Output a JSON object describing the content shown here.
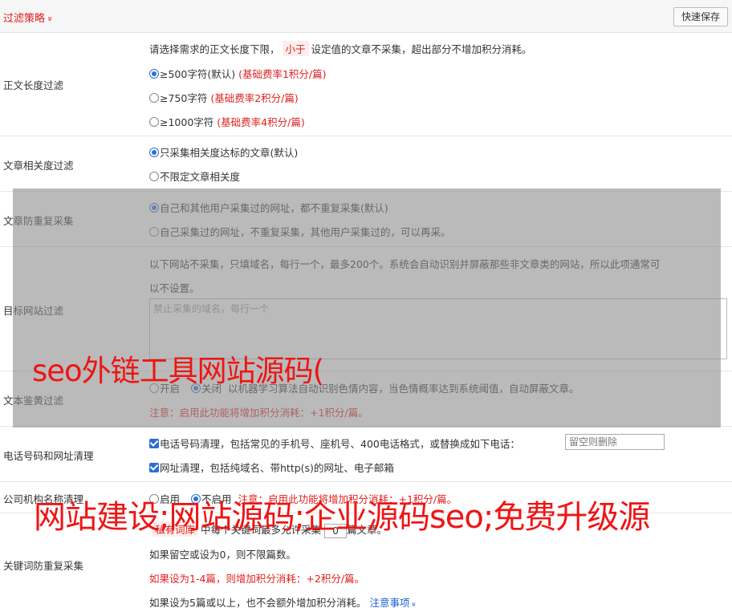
{
  "header": {
    "title": "过滤策略",
    "chevron": "»",
    "save_label": "快速保存"
  },
  "length_filter": {
    "label": "正文长度过滤",
    "desc_before": "请选择需求的正文长度下限，",
    "desc_tag": "小于",
    "desc_after": "设定值的文章不采集，超出部分不增加积分消耗。",
    "options": [
      {
        "text": "≥500字符(默认)",
        "rate": "(基础费率1积分/篇)",
        "selected": true
      },
      {
        "text": "≥750字符",
        "rate": "(基础费率2积分/篇)",
        "selected": false
      },
      {
        "text": "≥1000字符",
        "rate": "(基础费率4积分/篇)",
        "selected": false
      }
    ]
  },
  "relevance_filter": {
    "label": "文章相关度过滤",
    "options": [
      {
        "text": "只采集相关度达标的文章(默认)",
        "selected": true
      },
      {
        "text": "不限定文章相关度",
        "selected": false
      }
    ]
  },
  "dedup_filter": {
    "label": "文章防重复采集",
    "options": [
      {
        "text": "自己和其他用户采集过的网址，都不重复采集(默认)",
        "selected": true
      },
      {
        "text": "自己采集过的网址，不重复采集，其他用户采集过的，可以再采。",
        "selected": false
      }
    ]
  },
  "site_filter": {
    "label": "目标网站过滤",
    "desc_line1": "以下网站不采集，只填域名，每行一个，最多200个。系统会自动识别并屏蔽那些非文章类的网站，所以此项通常可",
    "desc_line2": "以不设置。",
    "placeholder": "禁止采集的域名，每行一个"
  },
  "porn_filter": {
    "label": "文本鉴黄过滤",
    "on_label": "开启",
    "off_label": "关闭",
    "selected": "off",
    "desc": "以机器学习算法自动识别色情内容，当色情概率达到系统阈值，自动屏蔽文章。",
    "notice": "注意：启用此功能将增加积分消耗：+1积分/篇。"
  },
  "contact_clean": {
    "label": "电话号码和网址清理",
    "phone_text": "电话号码清理，包括常见的手机号、座机号、400电话格式，或替换成如下电话：",
    "phone_placeholder": "留空则删除",
    "url_text": "网址清理，包括纯域名、带http(s)的网址、电子邮箱",
    "phone_checked": true,
    "url_checked": true
  },
  "company_clean": {
    "label": "公司机构名称清理",
    "on_label": "启用",
    "off_label": "不启用",
    "selected": "off",
    "notice": "注意：启用此功能将增加积分消耗：+1积分/篇。"
  },
  "keyword_dedup": {
    "label": "关键词防重复采集",
    "tag": "私有词库",
    "text_before": "中每个关键词最多允许采集",
    "value": "0",
    "text_after": "篇文章。",
    "line2": "如果留空或设为0，则不限篇数。",
    "line3": "如果设为1-4篇，则增加积分消耗：+2积分/篇。",
    "line4": "如果设为5篇或以上，也不会额外增加积分消耗。",
    "link": "注意事项",
    "link_chevron": "»"
  },
  "watermarks": {
    "line1": "seo外链工具网站源码(",
    "line2": "网站建设;网站源码;企业源码seo;免费升级源"
  },
  "colors": {
    "accent_red": "#e02020",
    "link_blue": "#1b5fd6",
    "radio_blue": "#2a6fd6",
    "overlay_gray": "#8c8c8c"
  }
}
